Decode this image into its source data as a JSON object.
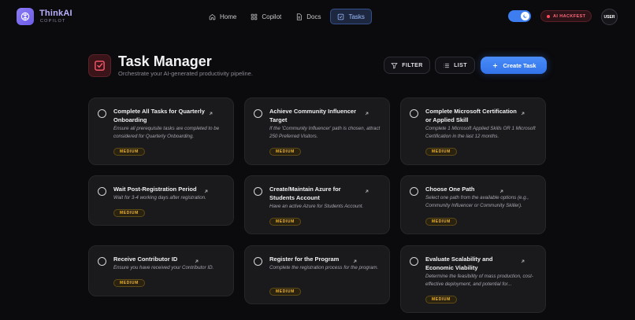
{
  "brand": {
    "title": "ThinkAI",
    "subtitle": "COPILOT"
  },
  "nav": {
    "items": [
      {
        "label": "Home",
        "icon": "home-icon"
      },
      {
        "label": "Copilot",
        "icon": "grid-icon"
      },
      {
        "label": "Docs",
        "icon": "document-icon"
      },
      {
        "label": "Tasks",
        "icon": "checkbox-icon",
        "active": true
      }
    ]
  },
  "header_right": {
    "badge": "AI HACKFEST",
    "avatar": "USER",
    "theme_toggle": "dark"
  },
  "page": {
    "title": "Task Manager",
    "subtitle": "Orchestrate your AI-generated productivity pipeline."
  },
  "toolbar": {
    "filter_label": "FILTER",
    "list_label": "LIST",
    "create_label": "Create Task"
  },
  "colors": {
    "accent": "#3d7df0",
    "badge_medium": "#f0b429",
    "hackfest": "#ff6a7a",
    "brand": "#8b7cf6"
  },
  "tasks": [
    {
      "title": "Complete All Tasks for Quarterly Onboarding",
      "description": "Ensure all prerequisite tasks are completed to be considered for Quarterly Onboarding.",
      "priority": "MEDIUM"
    },
    {
      "title": "Achieve Community Influencer Target",
      "description": "If the 'Community Influencer' path is chosen, attract 250 Preferred Visitors.",
      "priority": "MEDIUM"
    },
    {
      "title": "Complete Microsoft Certification or Applied Skill",
      "description": "Complete 1 Microsoft Applied Skills OR 1 Microsoft Certification in the last 12 months.",
      "priority": "MEDIUM"
    },
    {
      "title": "Wait Post-Registration Period",
      "description": "Wait for 3-4 working days after registration.",
      "priority": "MEDIUM"
    },
    {
      "title": "Create/Maintain Azure for Students Account",
      "description": "Have an active Azure for Students Account.",
      "priority": "MEDIUM"
    },
    {
      "title": "Choose One Path",
      "description": "Select one path from the available options (e.g., Community Influencer or Community Skiller).",
      "priority": "MEDIUM"
    },
    {
      "title": "Receive Contributor ID",
      "description": "Ensure you have received your Contributor ID.",
      "priority": "MEDIUM"
    },
    {
      "title": "Register for the Program",
      "description": "Complete the registration process for the program.",
      "priority": "MEDIUM"
    },
    {
      "title": "Evaluate Scalability and Economic Viability",
      "description": "Determine the feasibility of mass production, cost-effective deployment, and potential for...",
      "priority": "MEDIUM"
    }
  ]
}
